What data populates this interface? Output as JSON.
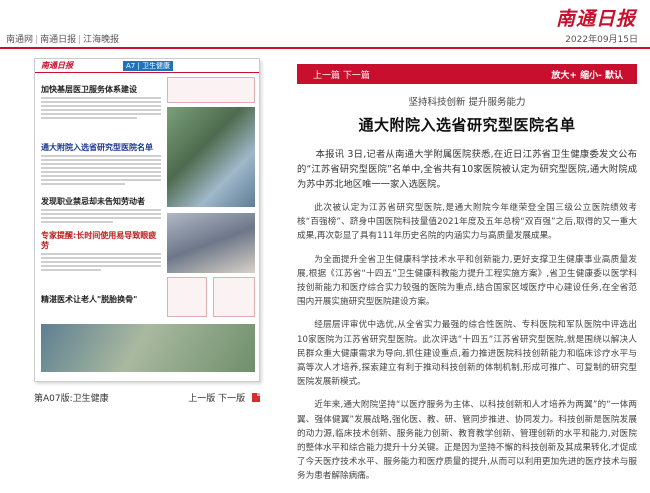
{
  "brand": {
    "logo_text": "南通日报"
  },
  "nav": {
    "links": [
      "南通网",
      "南通日报",
      "江海晚报"
    ],
    "separator": "|",
    "date": "2022年09月15日"
  },
  "thumbnail": {
    "paper_logo": "南通日报",
    "section_tag": "A7 | 卫生健康",
    "headlines": [
      "加快基层医卫服务体系建设",
      "通大附院入选省研究型医院名单",
      "发现职业禁忌却未告知劳动者",
      "专家提醒:长时间使用易导致眼疲劳",
      "精湛医术让老人\"脱胎换骨\""
    ]
  },
  "page_info": {
    "page_name": "第A07版:卫生健康",
    "prev_page": "上一版",
    "next_page": "下一版"
  },
  "toolbar": {
    "prev_article": "上一篇",
    "next_article": "下一篇",
    "zoom_in": "放大+",
    "zoom_out": "缩小-",
    "zoom_default": "默认"
  },
  "article": {
    "pretitle": "坚持科技创新 提升服务能力",
    "title": "通大附院入选省研究型医院名单",
    "paragraphs": [
      "本报讯 3日,记者从南通大学附属医院获悉,在近日江苏省卫生健康委发文公布的“江苏省研究型医院”名单中,全省共有10家医院被认定为研究型医院,通大附院成为苏中苏北地区唯一一家入选医院。",
      "此次被认定为江苏省研究型医院,是通大附院今年继荣登全国三级公立医院绩效考核“百强榜”、跻身中国医院科技量值2021年度及五年总榜“双百强”之后,取得的又一重大成果,再次彰显了具有111年历史名院的内涵实力与高质量发展成果。",
      "为全面提升全省卫生健康科学技术水平和创新能力,更好支撑卫生健康事业高质量发展,根据《江苏省“十四五”卫生健康科教能力提升工程实施方案》,省卫生健康委以医学科技创新能力和医疗综合实力较强的医院为重点,结合国家区域医疗中心建设任务,在全省范围内开展实施研究型医院建设方案。",
      "经层层评审优中选优,从全省实力最强的综合性医院、专科医院和军队医院中评选出10家医院为江苏省研究型医院。此次评选“十四五”江苏省研究型医院,就是围绕以解决人民群众重大健康需求为导向,抓住建设重点,着力推进医院科技创新能力和临床诊疗水平与高等次人才培养,探索建立有利于推动科技创新的体制机制,形成可推广、可复制的研究型医院发展新模式。",
      "近年来,通大附院坚持“以医疗服务为主体、以科技创新和人才培养为两翼”的“一体两翼、强体健翼”发展战略,强化医、教、研、管同步推进、协同发力。科技创新是医院发展的动力源,临床技术创新、服务能力创新、教育教学创新、管理创新的水平和能力,对医院的整体水平和综合能力提升十分关键。正是因为坚持不懈的科技创新及其成果转化,才促成了今天医疗技术水平、服务能力和医疗质量的提升,从而可以利用更加先进的医疗技术与服务为患者解除病痛。"
    ]
  }
}
